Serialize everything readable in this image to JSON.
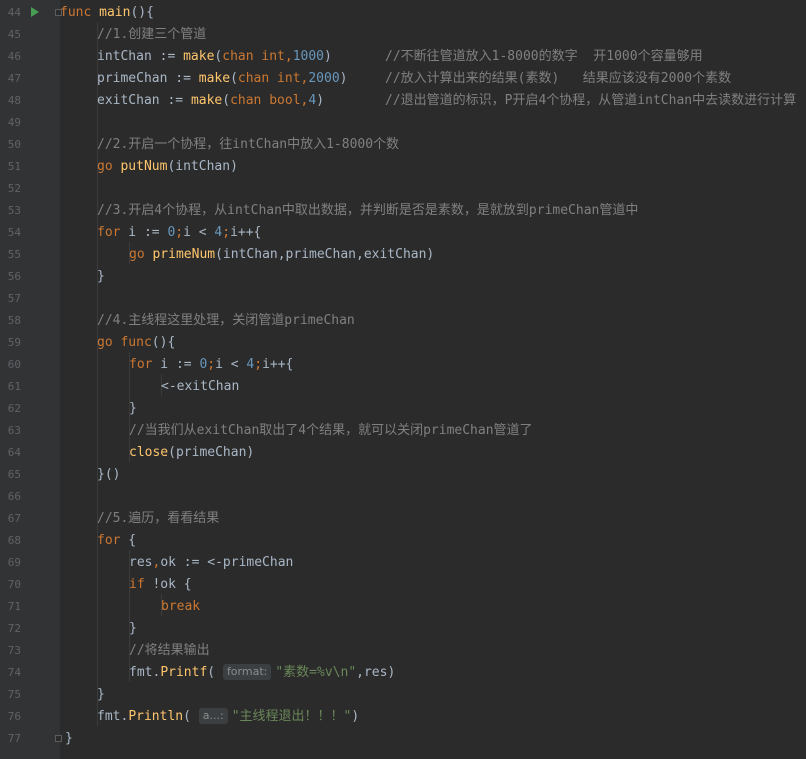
{
  "editor": {
    "line_numbers": [
      "44",
      "45",
      "46",
      "47",
      "48",
      "49",
      "50",
      "51",
      "52",
      "53",
      "54",
      "55",
      "56",
      "57",
      "58",
      "59",
      "60",
      "61",
      "62",
      "63",
      "64",
      "65",
      "66",
      "67",
      "68",
      "69",
      "70",
      "71",
      "72",
      "73",
      "74",
      "75",
      "76",
      "77"
    ],
    "tokens": {
      "func": "func",
      "main": "main",
      "paren_open_brace": "(){",
      "c1": "//1.创建三个管道",
      "intChan": "intChan",
      "primeChan": "primeChan",
      "exitChan": "exitChan",
      "assign": " := ",
      "make": "make",
      "lparen": "(",
      "rparen": ")",
      "chan": "chan",
      "int": "int",
      "bool": "bool",
      "comma": ",",
      "n1000": "1000",
      "n2000": "2000",
      "n4": "4",
      "c46": "//不断往管道放入1-8000的数字  开1000个容量够用",
      "c47": "//放入计算出来的结果(素数)   结果应该没有2000个素数",
      "c48": "//退出管道的标识，P开启4个协程，从管道intChan中去读数进行计算",
      "c2": "//2.开启一个协程，往intChan中放入1-8000个数",
      "go": "go",
      "putNum": "putNum",
      "putNum_args": "(intChan)",
      "c3": "//3.开启4个协程，从intChan中取出数据，并判断是否是素数，是就放到primeChan管道中",
      "for": "for",
      "i": " i",
      "zero": "0",
      "semi": ";",
      "i_lt": "i < ",
      "ipp": "i++{",
      "primeNum": "primeNum",
      "primeNum_args": "(intChan,primeChan,exitChan)",
      "rbrace": "}",
      "c4": "//4.主线程这里处理，关闭管道primeChan",
      "go_func": "func",
      "recv_exit": "<-exitChan",
      "c63": "//当我们从exitChan取出了4个结果，就可以关闭primeChan管道了",
      "close": "close",
      "close_args": "(primeChan)",
      "call_end": "}()",
      "c5": "//5.遍历，看看结果",
      "lbrace": " {",
      "res": "res",
      "ok": "ok",
      "recv_prime": " := <-primeChan",
      "if": "if",
      "not_ok": " !ok {",
      "break": "break",
      "c73": "//将结果输出",
      "fmt": "fmt",
      "dot": ".",
      "printf": "Printf",
      "println": "Println",
      "hint_format": "format:",
      "fmt_str": "\"素数=%v\\n\"",
      "res_end": ",res)",
      "hint_a": "a...:",
      "exit_str": "\"主线程退出！！！\"",
      "close_paren": ")"
    }
  },
  "colors": {
    "background": "#2b2b2b",
    "gutter": "#313335",
    "keyword": "#cc7832",
    "function": "#ffc66d",
    "number": "#6897bb",
    "comment": "#808080",
    "string": "#6a8759",
    "identifier": "#a9b7c6",
    "run_icon": "#499c54"
  },
  "icons": [
    "run-gutter-icon",
    "fold-marker-icon"
  ]
}
